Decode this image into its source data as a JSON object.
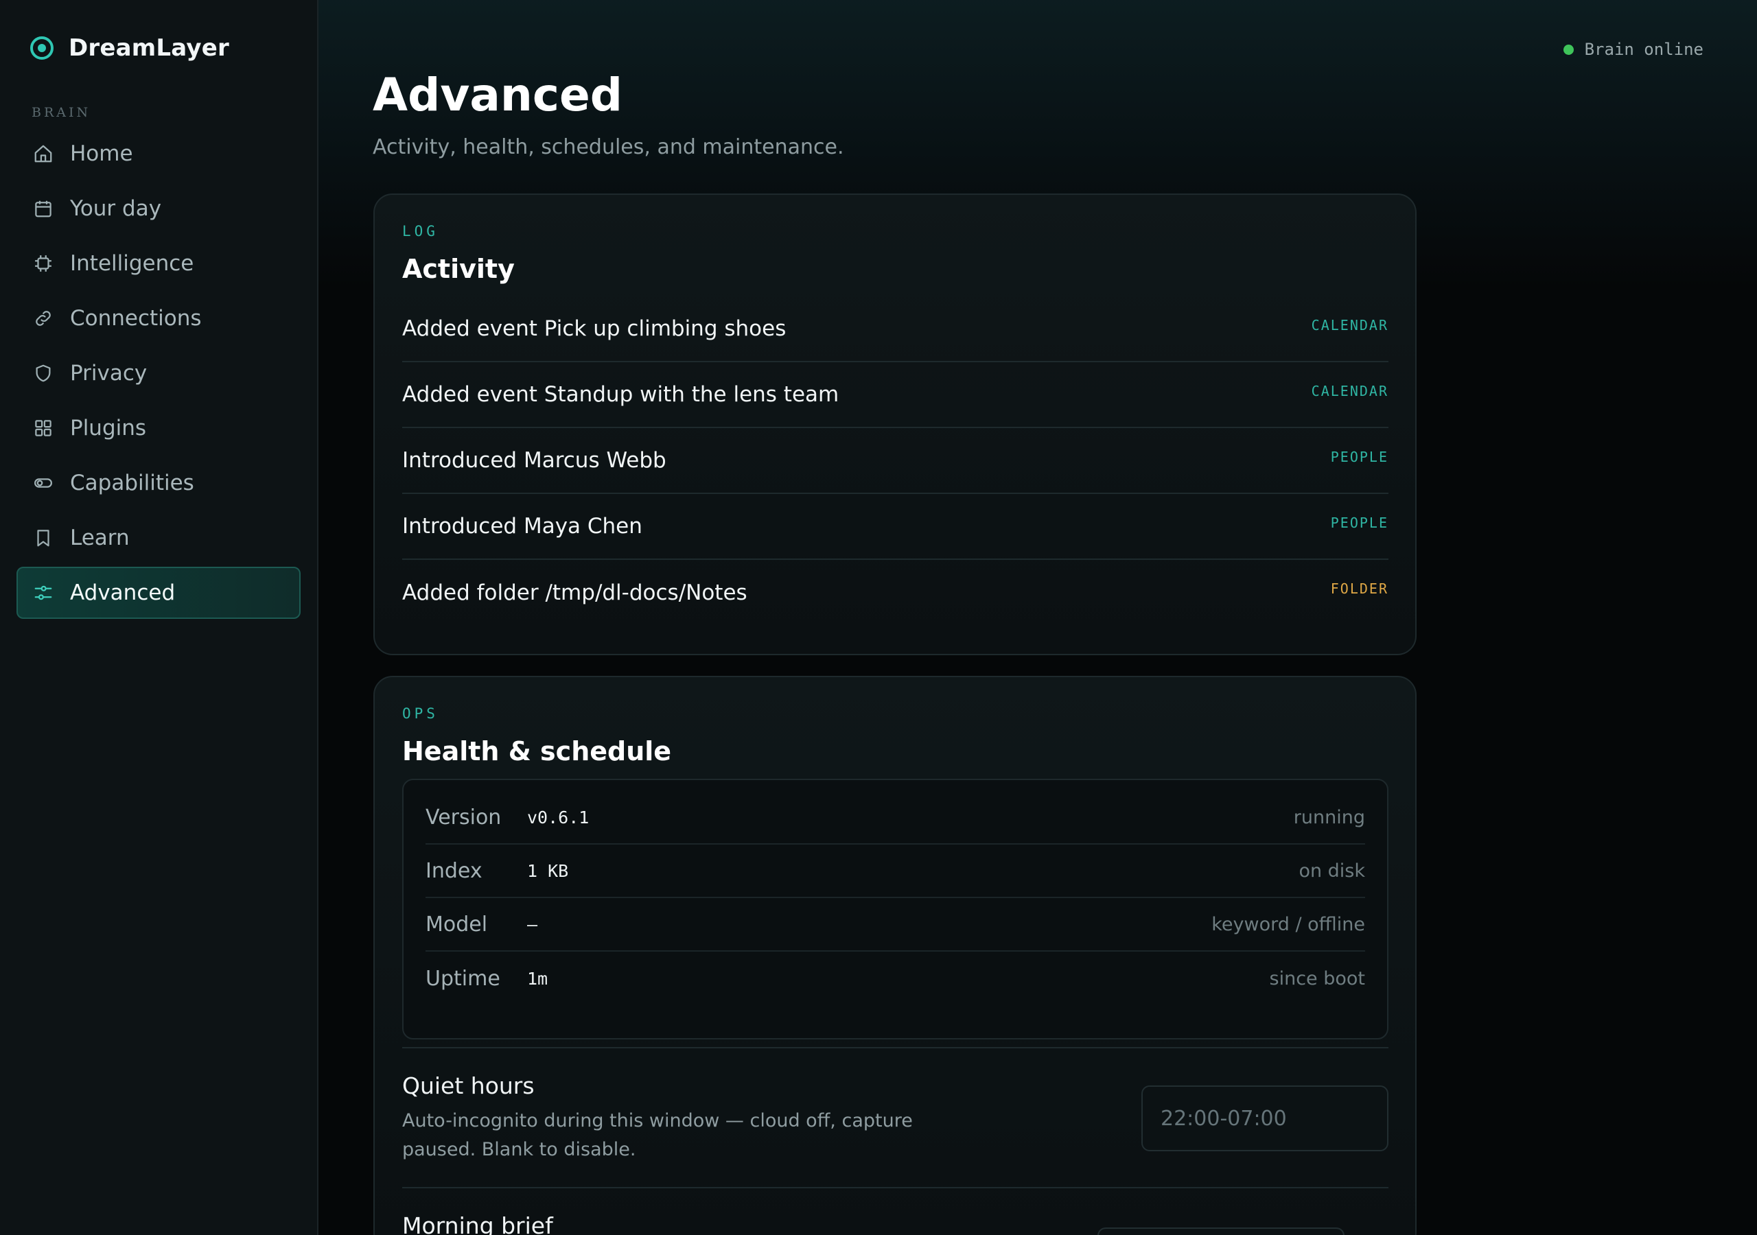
{
  "brand": {
    "name": "DreamLayer"
  },
  "sidebar": {
    "section_label": "BRAIN",
    "items": [
      {
        "label": "Home",
        "icon": "home-icon"
      },
      {
        "label": "Your day",
        "icon": "calendar-icon"
      },
      {
        "label": "Intelligence",
        "icon": "chip-icon"
      },
      {
        "label": "Connections",
        "icon": "link-icon"
      },
      {
        "label": "Privacy",
        "icon": "shield-icon"
      },
      {
        "label": "Plugins",
        "icon": "grid-icon"
      },
      {
        "label": "Capabilities",
        "icon": "toggle-icon"
      },
      {
        "label": "Learn",
        "icon": "bookmark-icon"
      },
      {
        "label": "Advanced",
        "icon": "sliders-icon",
        "active": true
      }
    ]
  },
  "status": {
    "label": "Brain online",
    "color": "#3fc45a"
  },
  "page": {
    "title": "Advanced",
    "subtitle": "Activity, health, schedules, and maintenance."
  },
  "activity": {
    "eyebrow": "LOG",
    "title": "Activity",
    "rows": [
      {
        "text": "Added event Pick up climbing shoes",
        "tag": "CALENDAR"
      },
      {
        "text": "Added event Standup with the lens team",
        "tag": "CALENDAR"
      },
      {
        "text": "Introduced Marcus Webb",
        "tag": "PEOPLE"
      },
      {
        "text": "Introduced Maya Chen",
        "tag": "PEOPLE"
      },
      {
        "text": "Added folder /tmp/dl-docs/Notes",
        "tag": "FOLDER"
      }
    ]
  },
  "ops": {
    "eyebrow": "OPS",
    "title": "Health & schedule",
    "stats": [
      {
        "key": "Version",
        "value": "v0.6.1",
        "note": "running"
      },
      {
        "key": "Index",
        "value": "1 KB",
        "note": "on disk"
      },
      {
        "key": "Model",
        "value": "–",
        "note": "keyword / offline"
      },
      {
        "key": "Uptime",
        "value": "1m",
        "note": "since boot"
      }
    ],
    "quiet_hours": {
      "title": "Quiet hours",
      "description": "Auto-incognito during this window — cloud off, capture paused. Blank to disable.",
      "placeholder": "22:00-07:00",
      "value": ""
    },
    "morning_brief": {
      "title": "Morning brief"
    }
  },
  "colors": {
    "accent": "#2fb6a4",
    "folder_tag": "#e0a846",
    "active_nav_bg": "#0e3b36"
  }
}
